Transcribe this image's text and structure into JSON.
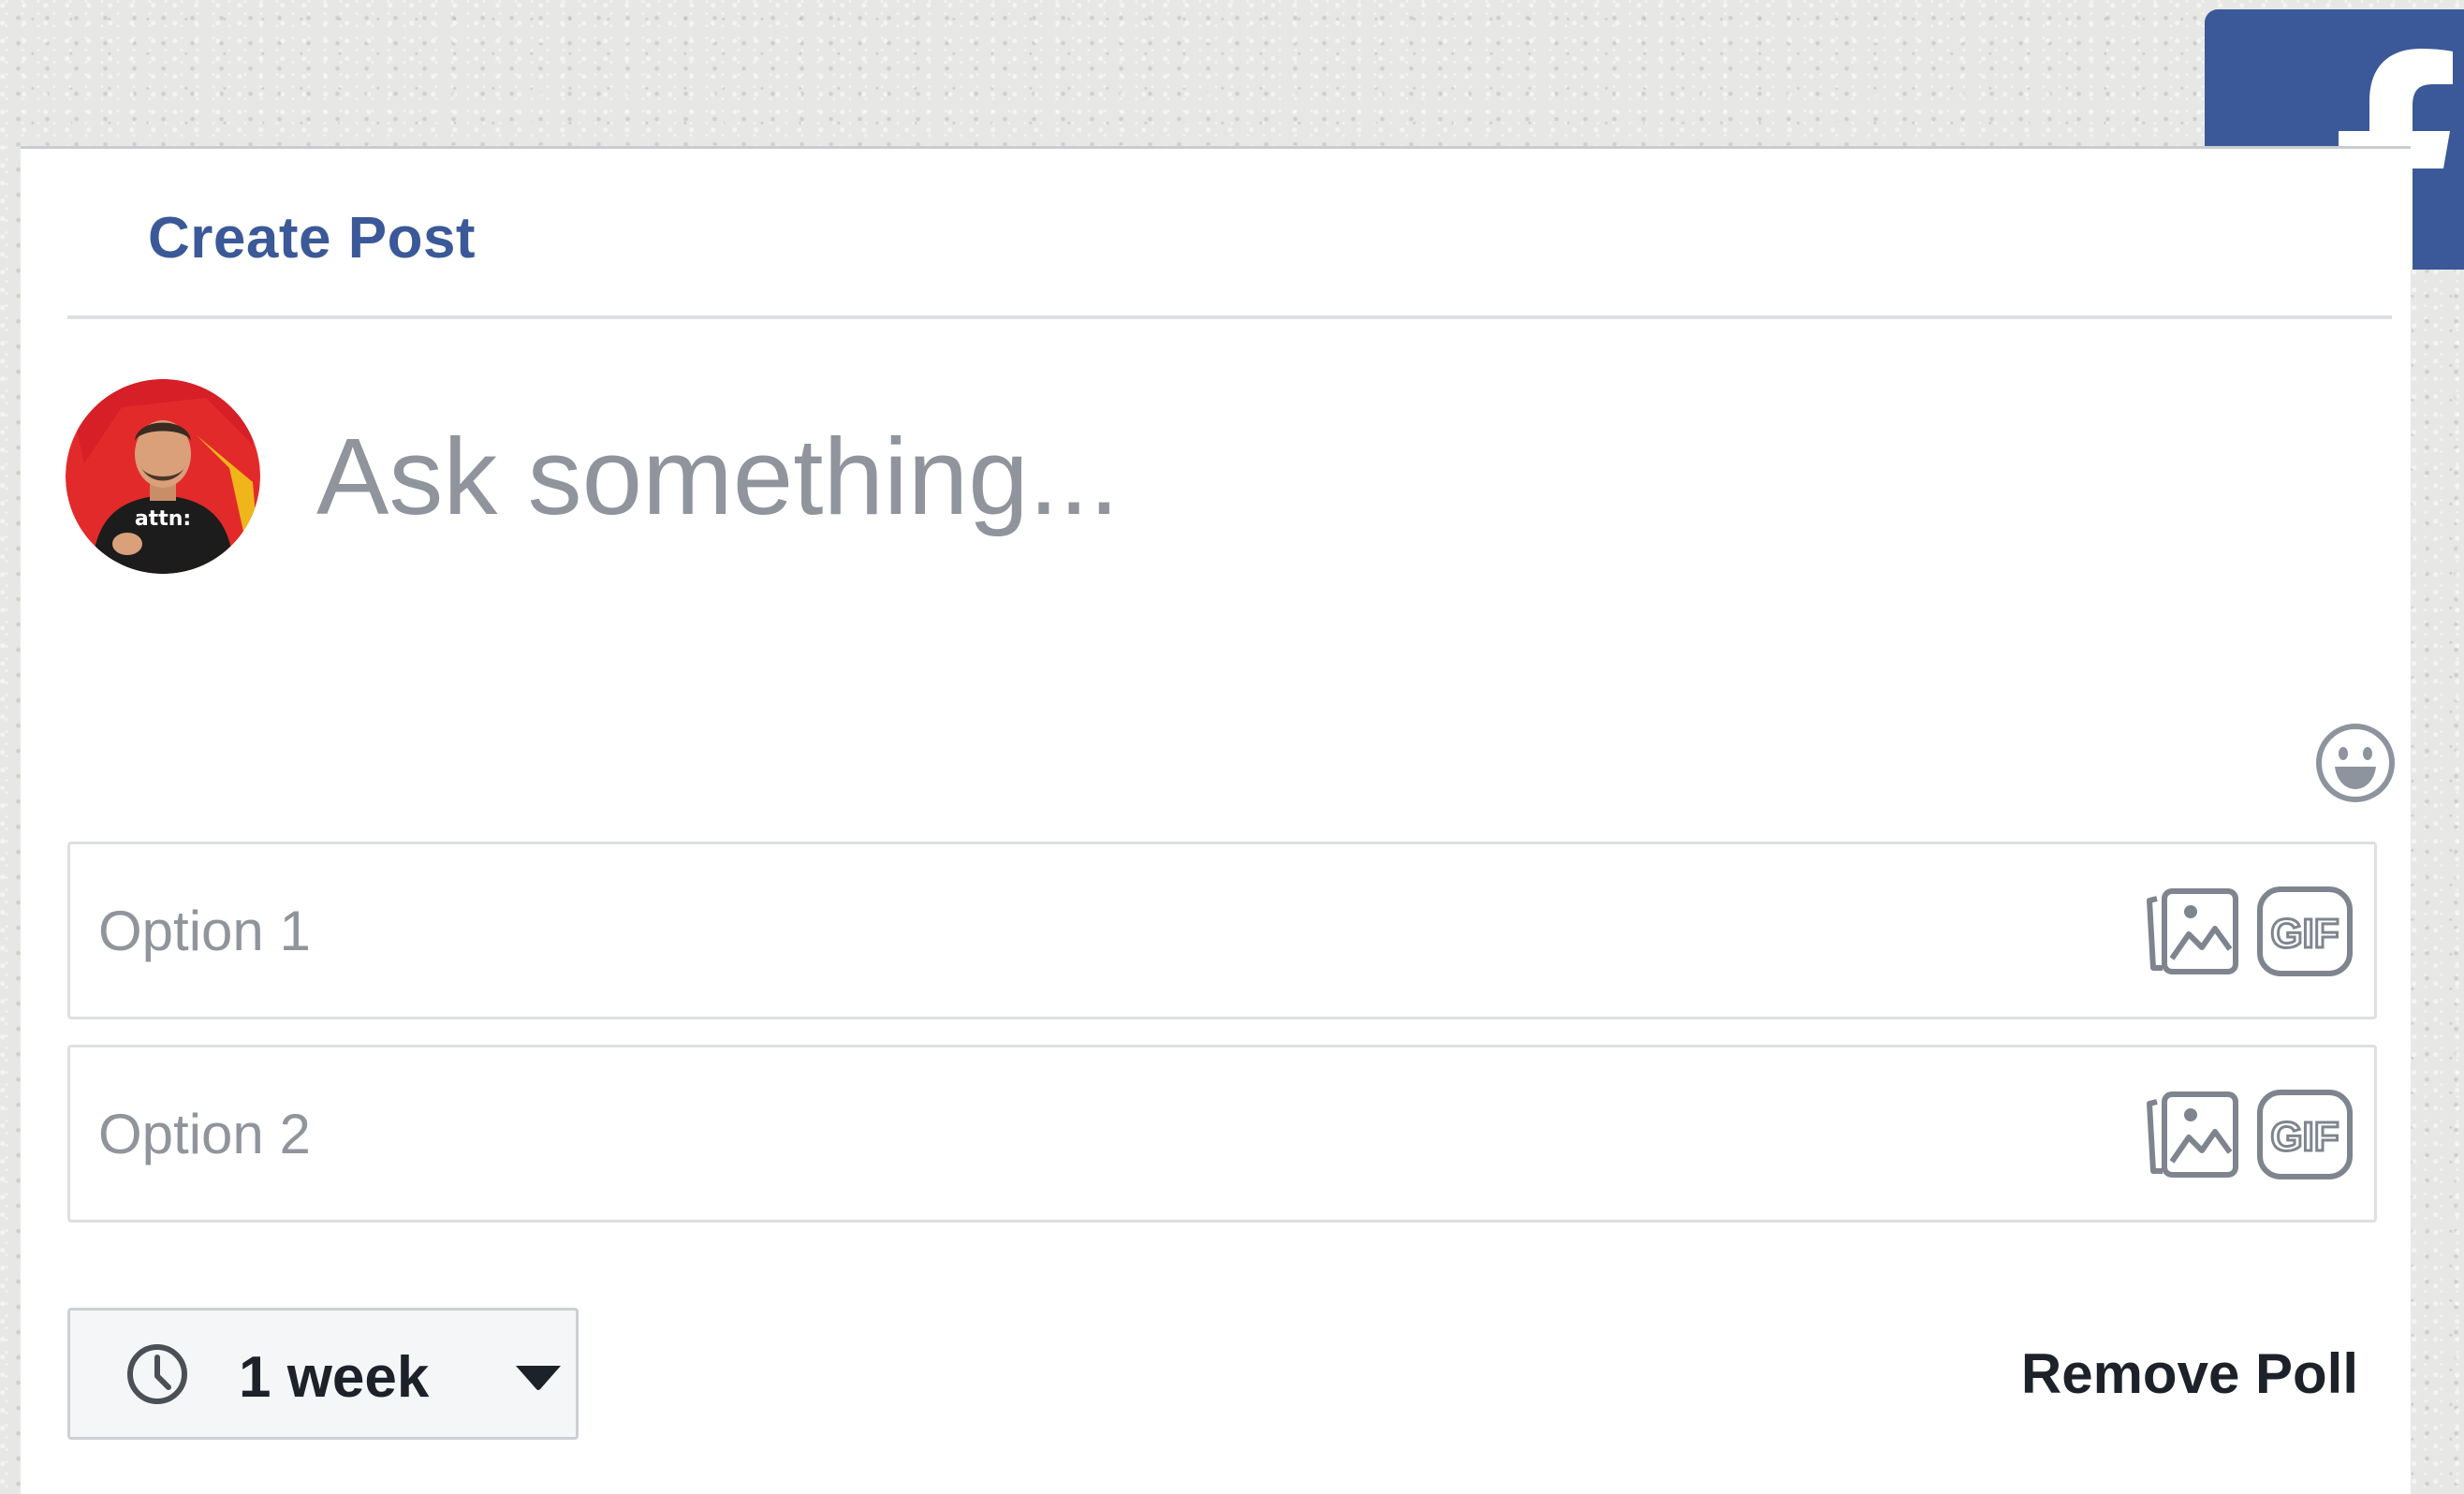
{
  "brand": {
    "name": "facebook",
    "logo_icon": "facebook-logo-icon",
    "color": "#3b5998"
  },
  "card": {
    "title": "Create Post"
  },
  "composer": {
    "avatar_alt": "profile-avatar",
    "placeholder": "Ask something...",
    "value": "",
    "emoji_icon": "emoji-smile-icon"
  },
  "poll": {
    "options": [
      {
        "placeholder": "Option 1",
        "value": "",
        "photo_icon": "add-photo-icon",
        "gif_icon": "gif-icon"
      },
      {
        "placeholder": "Option 2",
        "value": "",
        "photo_icon": "add-photo-icon",
        "gif_icon": "gif-icon"
      }
    ],
    "duration": {
      "label": "1 week",
      "icon": "clock-icon",
      "dropdown_icon": "caret-down-icon"
    },
    "remove_label": "Remove Poll"
  },
  "colors": {
    "accent": "#3b5998",
    "placeholder": "#90949c",
    "text": "#1d2129",
    "border": "#dddfe2",
    "icon": "#616770"
  }
}
